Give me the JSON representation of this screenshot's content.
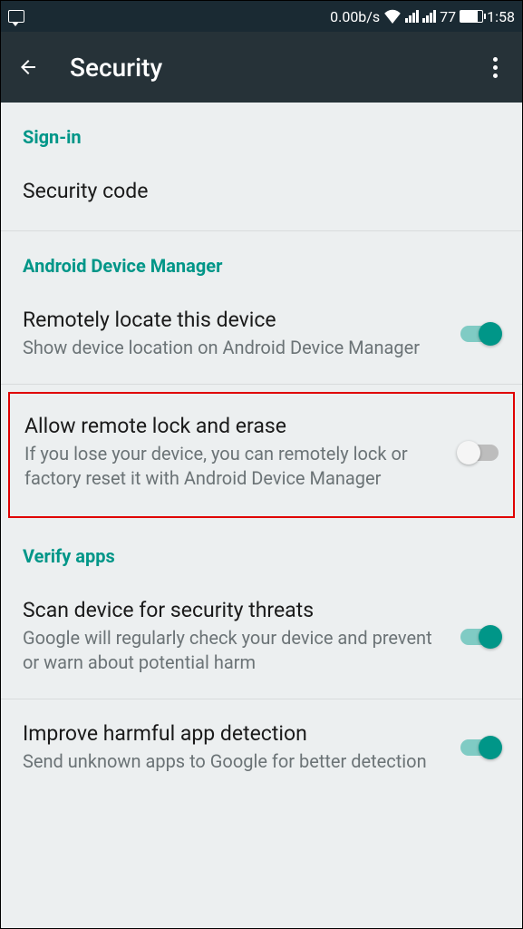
{
  "status_bar": {
    "data_rate": "0.00b/s",
    "battery_percent": "77",
    "time": "1:58"
  },
  "app_bar": {
    "title": "Security"
  },
  "sections": {
    "sign_in": {
      "header": "Sign-in",
      "items": {
        "security_code": {
          "title": "Security code"
        }
      }
    },
    "adm": {
      "header": "Android Device Manager",
      "items": {
        "remote_locate": {
          "title": "Remotely locate this device",
          "summary": "Show device location on Android Device Manager",
          "toggle": true
        },
        "remote_lock_erase": {
          "title": "Allow remote lock and erase",
          "summary": "If you lose your device, you can remotely lock or factory reset it with Android Device Manager",
          "toggle": false
        }
      }
    },
    "verify": {
      "header": "Verify apps",
      "items": {
        "scan_threats": {
          "title": "Scan device for security threats",
          "summary": "Google will regularly check your device and prevent or warn about potential harm",
          "toggle": true
        },
        "improve_detection": {
          "title": "Improve harmful app detection",
          "summary": "Send unknown apps to Google for better detection",
          "toggle": true
        }
      }
    }
  }
}
